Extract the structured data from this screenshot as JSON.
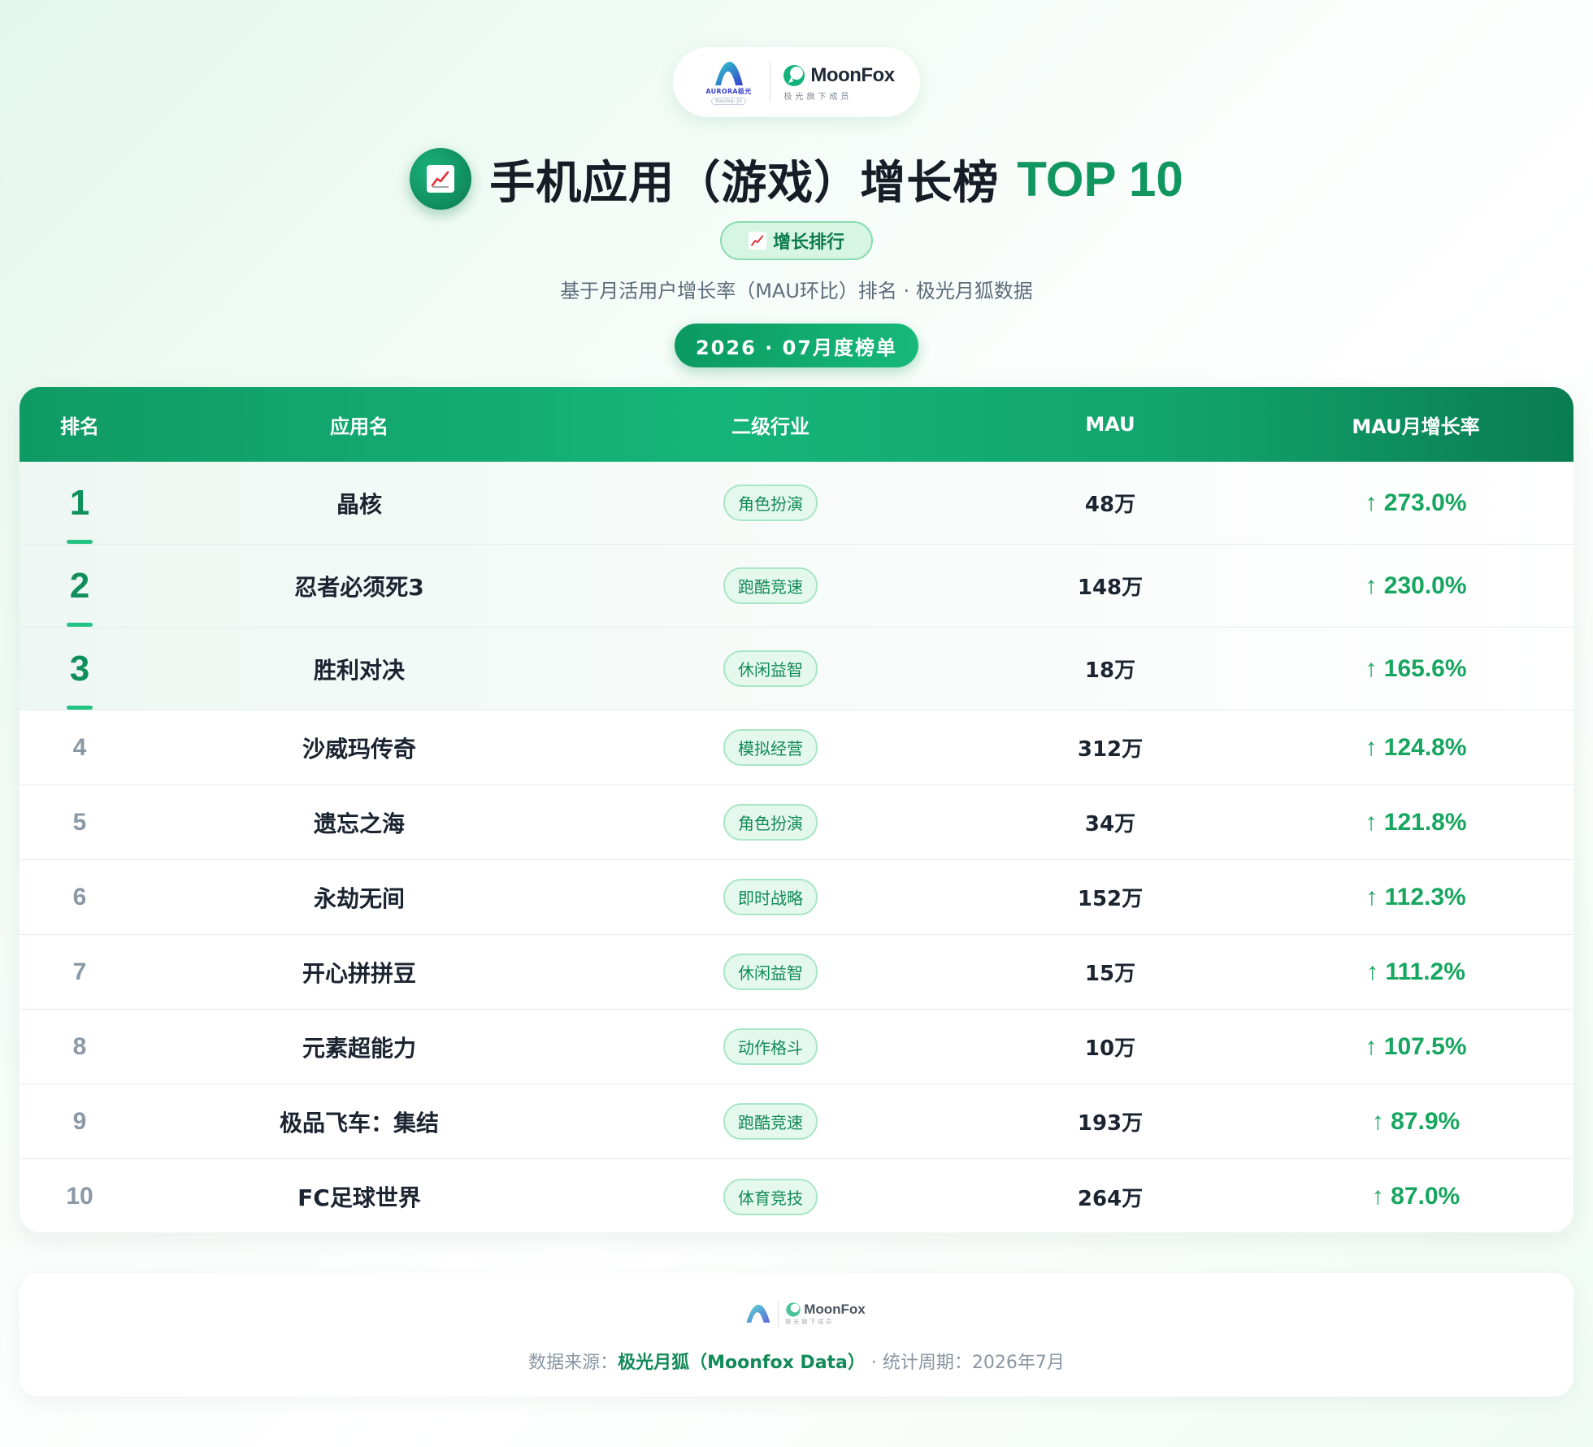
{
  "header": {
    "brand_left": {
      "name": "AURORA极光",
      "sub": "Nasdaq: JG"
    },
    "brand_right": {
      "name": "MoonFox",
      "sub": "极光旗下成员"
    },
    "title": "手机应用（游戏）增长榜",
    "title_accent": "TOP 10",
    "tag": "增长排行",
    "subtitle": "基于月活用户增长率（MAU环比）排名 · 极光月狐数据",
    "period_badge": "2026 · 07月度榜单",
    "icon_name": "chart-up-icon"
  },
  "table": {
    "columns": [
      "排名",
      "应用名",
      "二级行业",
      "MAU",
      "MAU月增长率"
    ],
    "rows": [
      {
        "rank": "1",
        "app": "晶核",
        "industry": "角色扮演",
        "mau": "48万",
        "growth": "↑ 273.0%"
      },
      {
        "rank": "2",
        "app": "忍者必须死3",
        "industry": "跑酷竞速",
        "mau": "148万",
        "growth": "↑ 230.0%"
      },
      {
        "rank": "3",
        "app": "胜利对决",
        "industry": "休闲益智",
        "mau": "18万",
        "growth": "↑ 165.6%"
      },
      {
        "rank": "4",
        "app": "沙威玛传奇",
        "industry": "模拟经营",
        "mau": "312万",
        "growth": "↑ 124.8%"
      },
      {
        "rank": "5",
        "app": "遗忘之海",
        "industry": "角色扮演",
        "mau": "34万",
        "growth": "↑ 121.8%"
      },
      {
        "rank": "6",
        "app": "永劫无间",
        "industry": "即时战略",
        "mau": "152万",
        "growth": "↑ 112.3%"
      },
      {
        "rank": "7",
        "app": "开心拼拼豆",
        "industry": "休闲益智",
        "mau": "15万",
        "growth": "↑ 111.2%"
      },
      {
        "rank": "8",
        "app": "元素超能力",
        "industry": "动作格斗",
        "mau": "10万",
        "growth": "↑ 107.5%"
      },
      {
        "rank": "9",
        "app": "极品飞车：集结",
        "industry": "跑酷竞速",
        "mau": "193万",
        "growth": "↑ 87.9%"
      },
      {
        "rank": "10",
        "app": "FC足球世界",
        "industry": "体育竞技",
        "mau": "264万",
        "growth": "↑ 87.0%"
      }
    ]
  },
  "footer": {
    "source_label": "数据来源：",
    "source_name": "极光月狐（Moonfox Data）",
    "period_label": " · 统计周期：",
    "period_value": "2026年7月"
  },
  "colors": {
    "accent": "#11965f",
    "accent_light": "#d6f5e3",
    "growth": "#17a65f"
  }
}
